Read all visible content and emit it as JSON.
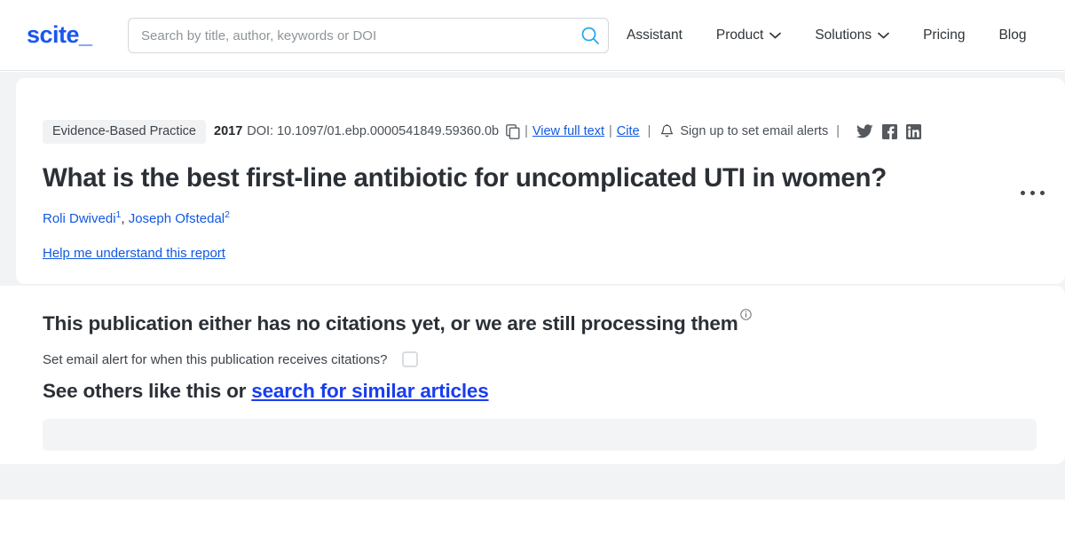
{
  "header": {
    "logo_text": "scite",
    "logo_underscore": "_",
    "search": {
      "placeholder": "Search by title, author, keywords or DOI",
      "value": "",
      "icon": "search-icon"
    },
    "nav": [
      {
        "label": "Assistant",
        "has_chevron": false
      },
      {
        "label": "Product",
        "has_chevron": true
      },
      {
        "label": "Solutions",
        "has_chevron": true
      },
      {
        "label": "Pricing",
        "has_chevron": false
      },
      {
        "label": "Blog",
        "has_chevron": false
      }
    ]
  },
  "publication": {
    "badge": "Evidence-Based Practice",
    "year": "2017",
    "doi": "DOI: 10.1097/01.ebp.0000541849.59360.0b",
    "copy_icon": "copy-icon",
    "view_full_text": "View full text",
    "cite": "Cite",
    "bell_icon": "bell-icon",
    "email_alerts": "Sign up to set email alerts",
    "socials": [
      "twitter-icon",
      "facebook-icon",
      "linkedin-icon"
    ],
    "kebab_icon": "more-options-icon",
    "title": "What is the best first-line antibiotic for uncomplicated UTI in women?",
    "authors": [
      {
        "name": "Roli Dwivedi",
        "affiliation": "1"
      },
      {
        "name": "Joseph Ofstedal",
        "affiliation": "2"
      }
    ],
    "help_link": "Help me understand this report"
  },
  "citations": {
    "no_citations_heading": "This publication either has no citations yet, or we are still processing them",
    "info_icon": "info-icon",
    "alert_label": "Set email alert for when this publication receives citations?",
    "checkbox_checked": false,
    "see_others_prefix": "See others like this or ",
    "see_others_link": "search for similar articles"
  },
  "colors": {
    "brand_blue": "#1a56f0",
    "link_blue": "#1259e0",
    "text_dark": "#2b3036",
    "page_gray": "#f2f3f4",
    "badge_gray": "#f1f2f3"
  }
}
